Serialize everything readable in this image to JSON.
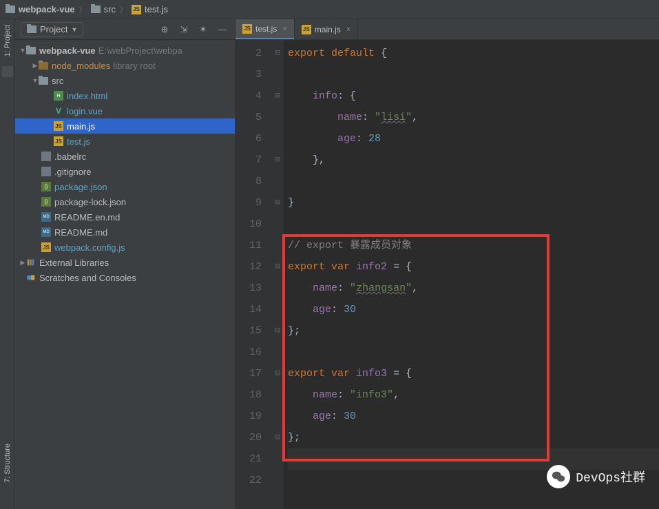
{
  "breadcrumb": {
    "root": "webpack-vue",
    "folder": "src",
    "file": "test.js"
  },
  "sidebar": {
    "title": "Project",
    "tree": {
      "root_name": "webpack-vue",
      "root_path": "E:\\webProject\\webpa",
      "node_modules": "node_modules",
      "node_modules_hint": "library root",
      "src": "src",
      "files": {
        "index_html": "index.html",
        "login_vue": "login.vue",
        "main_js": "main.js",
        "test_js": "test.js",
        "babelrc": ".babelrc",
        "gitignore": ".gitignore",
        "package_json": "package.json",
        "package_lock": "package-lock.json",
        "readme_en": "README.en.md",
        "readme": "README.md",
        "webpack_config": "webpack.config.js"
      },
      "external": "External Libraries",
      "scratches": "Scratches and Consoles"
    }
  },
  "gutters": {
    "project": "1: Project",
    "structure": "7: Structure"
  },
  "tabs": [
    {
      "label": "test.js",
      "active": true
    },
    {
      "label": "main.js",
      "active": false
    }
  ],
  "code_lines": [
    {
      "n": 2,
      "html": "<span class='kw'>export default</span> <span class='punct'>{</span>"
    },
    {
      "n": 3,
      "html": ""
    },
    {
      "n": 4,
      "html": "    <span class='prop'>info</span><span class='punct'>: {</span>"
    },
    {
      "n": 5,
      "html": "        <span class='prop'>name</span><span class='punct'>: </span><span class='str'>\"<span class='underline'>lisi</span>\"</span><span class='punct'>,</span>"
    },
    {
      "n": 6,
      "html": "        <span class='prop'>age</span><span class='punct'>: </span><span class='num'>28</span>"
    },
    {
      "n": 7,
      "html": "    <span class='punct'>},</span>"
    },
    {
      "n": 8,
      "html": ""
    },
    {
      "n": 9,
      "html": "<span class='punct'>}</span>"
    },
    {
      "n": 10,
      "html": ""
    },
    {
      "n": 11,
      "html": "<span class='comment'>// export 暴露成员对象</span>"
    },
    {
      "n": 12,
      "html": "<span class='kw'>export var</span> <span class='prop'>info2</span> <span class='punct'>= {</span>"
    },
    {
      "n": 13,
      "html": "    <span class='prop'>name</span><span class='punct'>: </span><span class='str'>\"<span class='underline'>zhangsan</span>\"</span><span class='punct'>,</span>"
    },
    {
      "n": 14,
      "html": "    <span class='prop'>age</span><span class='punct'>: </span><span class='num'>30</span>"
    },
    {
      "n": 15,
      "html": "<span class='punct'>};</span>"
    },
    {
      "n": 16,
      "html": ""
    },
    {
      "n": 17,
      "html": "<span class='kw'>export var</span> <span class='prop'>info3</span> <span class='punct'>= {</span>"
    },
    {
      "n": 18,
      "html": "    <span class='prop'>name</span><span class='punct'>: </span><span class='str'>\"info3\"</span><span class='punct'>,</span>"
    },
    {
      "n": 19,
      "html": "    <span class='prop'>age</span><span class='punct'>: </span><span class='num'>30</span>"
    },
    {
      "n": 20,
      "html": "<span class='punct'>};</span>"
    },
    {
      "n": 21,
      "html": "",
      "class": "line21"
    },
    {
      "n": 22,
      "html": ""
    }
  ],
  "fold_marks": {
    "2": true,
    "4": true,
    "7": true,
    "9": true,
    "12": true,
    "15": true,
    "17": true,
    "20": true
  },
  "watermark": "DevOps社群"
}
